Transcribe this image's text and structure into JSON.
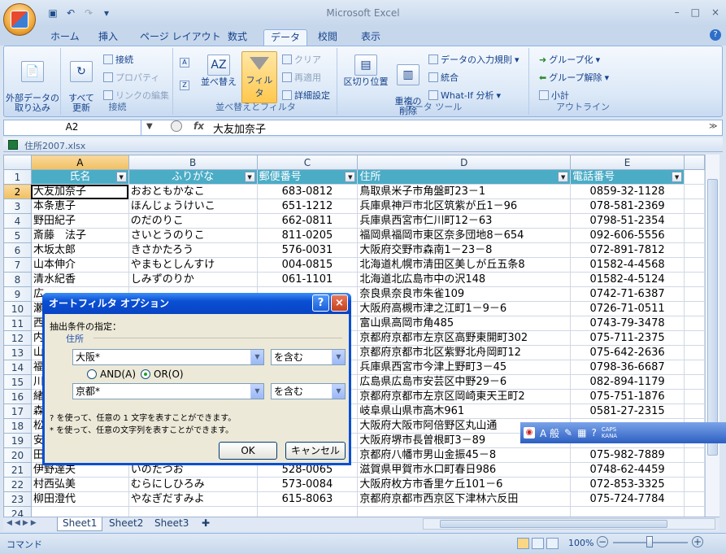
{
  "app": {
    "title": "Microsoft Excel",
    "win_min": "–",
    "win_max": "□",
    "win_close": "×"
  },
  "tabs": [
    "ホーム",
    "挿入",
    "ページ レイアウト",
    "数式",
    "データ",
    "校閲",
    "表示"
  ],
  "active_tab": "データ",
  "ribbon": {
    "external_data": "外部データの\n取り込み",
    "refresh": "すべて\n更新",
    "connections": "接続",
    "properties": "プロパティ",
    "edit_links": "リンクの編集",
    "group_connections": "接続",
    "sort": "並べ替え",
    "filter": "フィルタ",
    "clear": "クリア",
    "reapply": "再適用",
    "advanced": "詳細設定",
    "group_sort": "並べ替えとフィルタ",
    "text_to_columns": "区切り位置",
    "remove_dup": "重複の\n削除",
    "validation": "データの入力規則",
    "consolidate": "統合",
    "whatif": "What-If 分析",
    "group_tools": "データ ツール",
    "group": "グループ化",
    "ungroup": "グループ解除",
    "subtotal": "小計",
    "group_outline": "アウトライン"
  },
  "formula_bar": {
    "name_box": "A2",
    "fx": "fx",
    "content": "大友加奈子"
  },
  "workbook": {
    "title": "住所2007.xlsx"
  },
  "columns": [
    "A",
    "B",
    "C",
    "D",
    "E"
  ],
  "headers": [
    "氏名",
    "ふりがな",
    "郵便番号",
    "住所",
    "電話番号"
  ],
  "rows": [
    [
      "2",
      "大友加奈子",
      "おおともかなこ",
      "683-0812",
      "鳥取県米子市角盤町23－1",
      "0859-32-1128"
    ],
    [
      "3",
      "本条恵子",
      "ほんじょうけいこ",
      "651-1212",
      "兵庫県神戸市北区筑紫が丘1－96",
      "078-581-2369"
    ],
    [
      "4",
      "野田紀子",
      "のだのりこ",
      "662-0811",
      "兵庫県西宮市仁川町12－63",
      "0798-51-2354"
    ],
    [
      "5",
      "斎藤　法子",
      "さいとうのりこ",
      "811-0205",
      "福岡県福岡市東区奈多団地8－654",
      "092-606-5556"
    ],
    [
      "6",
      "木坂太郎",
      "きさかたろう",
      "576-0031",
      "大阪府交野市森南1－23－8",
      "072-891-7812"
    ],
    [
      "7",
      "山本伸介",
      "やまもとしんすけ",
      "004-0815",
      "北海道札幌市清田区美しが丘五条8",
      "01582-4-4568"
    ],
    [
      "8",
      "清水紀香",
      "しみずのりか",
      "061-1101",
      "北海道北広島市中の沢148",
      "01582-4-5124"
    ],
    [
      "9",
      "広",
      "",
      "",
      "奈良県奈良市朱雀109",
      "0742-71-6387"
    ],
    [
      "10",
      "瀬",
      "",
      "",
      "大阪府高槻市津之江町1－9－6",
      "0726-71-0511"
    ],
    [
      "11",
      "西",
      "",
      "",
      "富山県高岡市角485",
      "0743-79-3478"
    ],
    [
      "12",
      "内",
      "",
      "",
      "京都府京都市左京区高野東開町302",
      "075-711-2375"
    ],
    [
      "13",
      "山",
      "",
      "",
      "京都府京都市北区紫野北舟岡町12",
      "075-642-2636"
    ],
    [
      "14",
      "福",
      "",
      "",
      "兵庫県西宮市今津上野町3－45",
      "0798-36-6687"
    ],
    [
      "15",
      "川",
      "",
      "",
      "広島県広島市安芸区中野29－6",
      "082-894-1179"
    ],
    [
      "16",
      "緒",
      "",
      "",
      "京都府京都市左京区岡崎東天王町2",
      "075-751-1876"
    ],
    [
      "17",
      "森",
      "",
      "",
      "岐阜県山県市高木961",
      "0581-27-2315"
    ],
    [
      "18",
      "松",
      "",
      "",
      "大阪府大阪市阿倍野区丸山通",
      ""
    ],
    [
      "19",
      "安",
      "",
      "",
      "大阪府堺市長曽根町3－89",
      ""
    ],
    [
      "20",
      "田",
      "",
      "",
      "京都府八幡市男山金振45－8",
      "075-982-7889"
    ],
    [
      "21",
      "伊野達夫",
      "いのたつお",
      "528-0065",
      "滋賀県甲賀市水口町春日986",
      "0748-62-4459"
    ],
    [
      "22",
      "村西弘美",
      "むらにしひろみ",
      "573-0084",
      "大阪府枚方市香里ケ丘101－6",
      "072-853-3325"
    ],
    [
      "23",
      "柳田澄代",
      "やなぎだすみよ",
      "615-8063",
      "京都府京都市西京区下津林六反田",
      "075-724-7784"
    ],
    [
      "24",
      "",
      "",
      "",
      "",
      ""
    ]
  ],
  "sheets": [
    "Sheet1",
    "Sheet2",
    "Sheet3"
  ],
  "status": {
    "mode": "コマンド",
    "zoom": "100%"
  },
  "dialog": {
    "title": "オートフィルタ オプション",
    "criteria_label": "抽出条件の指定：",
    "field": "住所",
    "cond1_value": "大阪*",
    "cond1_op": "を含む",
    "and_label": "AND(A)",
    "or_label": "OR(O)",
    "cond2_value": "京都*",
    "cond2_op": "を含む",
    "hint1": "? を使って、任意の 1 文字を表すことができます。",
    "hint2": "* を使って、任意の文字列を表すことができます。",
    "ok": "OK",
    "cancel": "キャンセル"
  },
  "ime": {
    "mode": "A 般",
    "caps": "CAPS",
    "kana": "KANA"
  }
}
